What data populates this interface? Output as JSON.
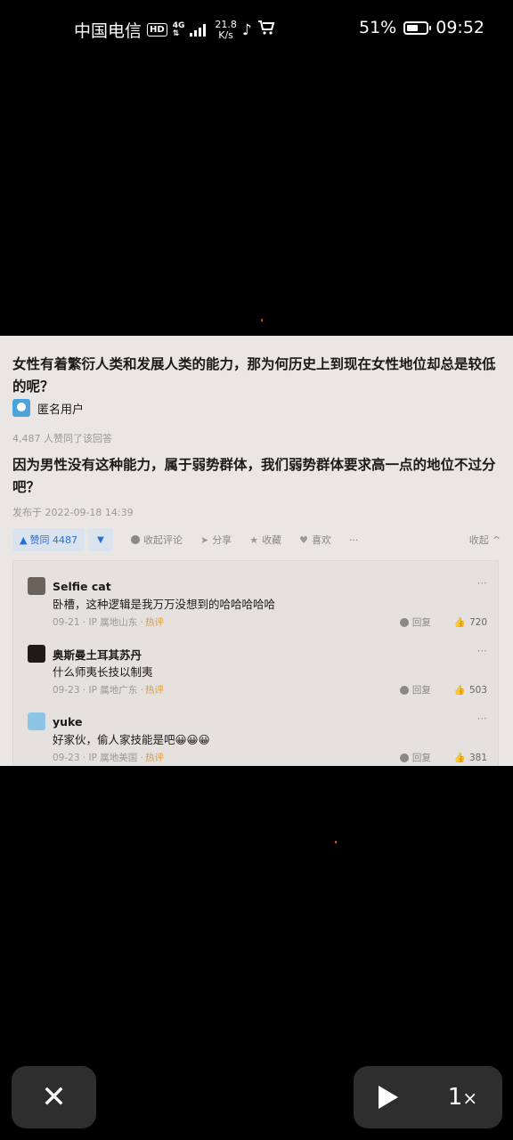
{
  "status_bar": {
    "carrier": "中国电信",
    "hd": "HD",
    "network": "4G",
    "speed_value": "21.8",
    "speed_unit": "K/s",
    "battery": "51%",
    "time": "09:52"
  },
  "question": {
    "title": "女性有着繁衍人类和发展人类的能力，那为何历史上到现在女性地位却总是较低的呢？",
    "author": "匿名用户",
    "upvote_meta": "4,487 人赞同了该回答",
    "answer": "因为男性没有这种能力，属于弱势群体，我们弱势群体要求高一点的地位不过分吧？",
    "published": "发布于 2022-09-18 14:39"
  },
  "actions": {
    "upvote": "赞同 4487",
    "comments": "收起评论",
    "share": "分享",
    "favorite": "收藏",
    "like": "喜欢",
    "more": "···",
    "collapse": "收起"
  },
  "comments": [
    {
      "name": "Selfie cat",
      "text": "卧槽，这种逻辑是我万万没想到的哈哈哈哈哈",
      "date": "09-21 · IP 属地山东 ·",
      "tag": "热评",
      "reply": "回复",
      "likes": "720",
      "more": "···"
    },
    {
      "name": "奥斯曼土耳其苏丹",
      "text": "什么师夷长技以制夷",
      "date": "09-23 · IP 属地广东 ·",
      "tag": "热评",
      "reply": "回复",
      "likes": "503",
      "more": "···"
    },
    {
      "name": "yuke",
      "text": "好家伙，偷人家技能是吧😀😀😀",
      "date": "09-23 · IP 属地美国 ·",
      "tag": "热评",
      "reply": "回复",
      "likes": "381",
      "more": "···"
    }
  ],
  "player": {
    "speed": "1",
    "speed_suffix": "×"
  },
  "colors": {
    "background": "#000000",
    "card": "#eae6e3",
    "accent": "#2b6fd6",
    "hot_tag": "#e69b2b"
  }
}
